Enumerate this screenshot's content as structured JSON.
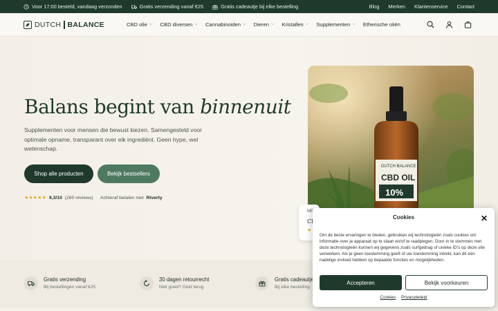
{
  "topbar": {
    "left": [
      {
        "icon": "clock-icon",
        "text": "Voor 17:00 besteld, vandaag verzonden"
      },
      {
        "icon": "truck-icon",
        "text": "Gratis verzending vanaf €25"
      },
      {
        "icon": "gift-icon",
        "text": "Gratis cadeautje bij elke bestelling"
      }
    ],
    "right": [
      "Blog",
      "Merken",
      "Klantenservice",
      "Contact"
    ]
  },
  "logo": {
    "left": "DUTCH",
    "right": "BALANCE"
  },
  "menu": [
    {
      "label": "CBD olie",
      "has_dropdown": true
    },
    {
      "label": "CBD diversen",
      "has_dropdown": true
    },
    {
      "label": "Cannabinoiden",
      "has_dropdown": true
    },
    {
      "label": "Dieren",
      "has_dropdown": true
    },
    {
      "label": "Kristallen",
      "has_dropdown": true
    },
    {
      "label": "Supplementen",
      "has_dropdown": true
    },
    {
      "label": "Etherische oliën",
      "has_dropdown": false
    }
  ],
  "hero": {
    "title_plain": "Balans begint van ",
    "title_italic": "binnenuit",
    "subtitle": "Supplementen voor mensen die bewust kiezen. Samengesteld voor optimale opname, transparant over elk ingrediënt. Geen hype, wel wetenschap.",
    "primary_button": "Shop alle producten",
    "secondary_button": "Bekijk bestsellers",
    "stars": "★★★★★",
    "rating_score": "9,3/10",
    "rating_count": "(260 reviews)",
    "payment_prefix": "Achteraf betalen met",
    "payment_brand": "Riverty"
  },
  "product_image": {
    "brand": "DUTCH BALANCE",
    "label_line1": "CBD OIL",
    "label_line2": "10%"
  },
  "floating_card": {
    "line1": "ME",
    "line2": "CE",
    "stars": "★"
  },
  "usps": [
    {
      "icon": "truck-icon",
      "title": "Gratis verzending",
      "desc": "Bij bestellingen vanaf €25"
    },
    {
      "icon": "return-icon",
      "title": "30 dagen retourrecht",
      "desc": "Niet goed? Geld terug"
    },
    {
      "icon": "gift-icon",
      "title": "Gratis cadeautje",
      "desc": "Bij elke bestelling"
    }
  ],
  "cookie": {
    "title": "Cookies",
    "body": "Om de beste ervaringen te bieden, gebruiken wij technologieën zoals cookies om informatie over je apparaat op te slaan en/of te raadplegen. Door in te stemmen met deze technologieën kunnen wij gegevens zoals surfgedrag of unieke ID's op deze site verwerken. Als je geen toestemming geeft of uw toestemming intrekt, kan dit een nadelige invloed hebben op bepaalde functies en mogelijkheden.",
    "accept": "Accepteren",
    "preferences": "Bekijk voorkeuren",
    "link1": "Cookies",
    "link2": "Privacybeleid"
  },
  "colors": {
    "brand_dark": "#1f3a2c",
    "brand_mid": "#4f7a62",
    "star": "#e0a91f"
  }
}
